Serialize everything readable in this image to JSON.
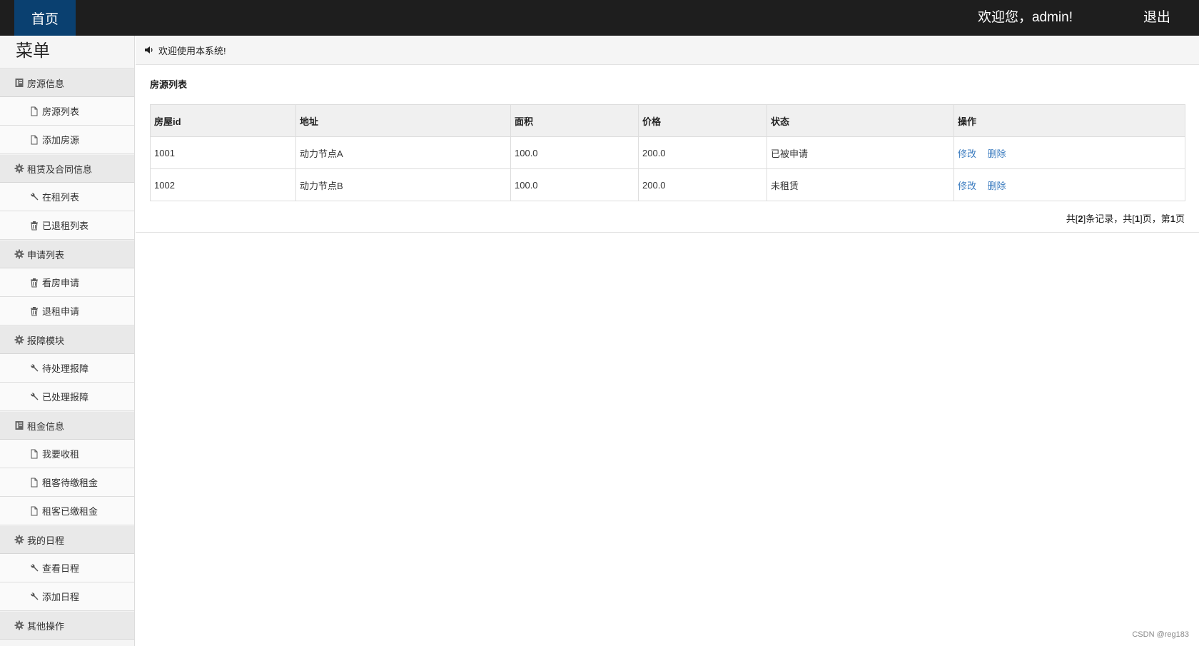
{
  "topbar": {
    "home_label": "首页",
    "welcome_text": "欢迎您，admin!",
    "logout_label": "退出"
  },
  "sidebar": {
    "title": "菜单",
    "groups": [
      {
        "label": "房源信息",
        "icon": "book-icon",
        "items": [
          {
            "label": "房源列表",
            "icon": "file-icon"
          },
          {
            "label": "添加房源",
            "icon": "file-icon"
          }
        ]
      },
      {
        "label": "租赁及合同信息",
        "icon": "gear-icon",
        "items": [
          {
            "label": "在租列表",
            "icon": "wrench-icon"
          },
          {
            "label": "已退租列表",
            "icon": "trash-icon"
          }
        ]
      },
      {
        "label": "申请列表",
        "icon": "gear-icon",
        "items": [
          {
            "label": "看房申请",
            "icon": "trash-icon"
          },
          {
            "label": "退租申请",
            "icon": "trash-icon"
          }
        ]
      },
      {
        "label": "报障模块",
        "icon": "gear-icon",
        "items": [
          {
            "label": "待处理报障",
            "icon": "wrench-icon"
          },
          {
            "label": "已处理报障",
            "icon": "wrench-icon"
          }
        ]
      },
      {
        "label": "租金信息",
        "icon": "book-icon",
        "items": [
          {
            "label": "我要收租",
            "icon": "file-icon"
          },
          {
            "label": "租客待缴租金",
            "icon": "file-icon"
          },
          {
            "label": "租客已缴租金",
            "icon": "file-icon"
          }
        ]
      },
      {
        "label": "我的日程",
        "icon": "gear-icon",
        "items": [
          {
            "label": "查看日程",
            "icon": "wrench-icon"
          },
          {
            "label": "添加日程",
            "icon": "wrench-icon"
          }
        ]
      },
      {
        "label": "其他操作",
        "icon": "gear-icon",
        "items": []
      }
    ]
  },
  "notice": {
    "text": "欢迎使用本系统!",
    "icon": "volume-icon"
  },
  "panel": {
    "title": "房源列表",
    "columns": [
      "房屋id",
      "地址",
      "面积",
      "价格",
      "状态",
      "操作"
    ],
    "rows": [
      {
        "id": "1001",
        "address": "动力节点A",
        "area": "100.0",
        "price": "200.0",
        "status": "已被申请",
        "edit": "修改",
        "delete": "删除"
      },
      {
        "id": "1002",
        "address": "动力节点B",
        "area": "100.0",
        "price": "200.0",
        "status": "未租赁",
        "edit": "修改",
        "delete": "删除"
      }
    ],
    "pager": {
      "prefix": "共[",
      "total_records": "2",
      "mid1": "]条记录，共[",
      "total_pages": "1",
      "mid2": "]页，第",
      "current_page": "1",
      "suffix": "页"
    }
  },
  "watermark": "CSDN @reg183",
  "colors": {
    "topbar": "#1e1e1e",
    "home_tab": "#0a4070",
    "link": "#3a7bbf"
  }
}
